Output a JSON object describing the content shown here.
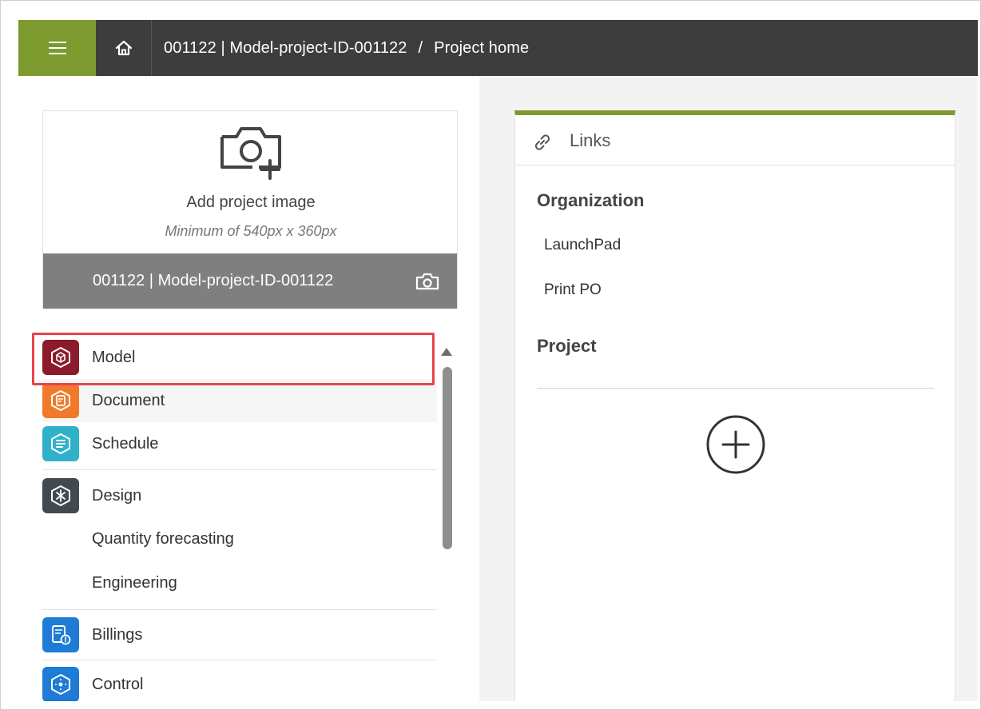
{
  "header": {
    "project": "001122 | Model-project-ID-001122",
    "separator": "/",
    "page": "Project home"
  },
  "project_image": {
    "add_label": "Add project image",
    "min_size": "Minimum of 540px x 360px",
    "project_name": "001122 | Model-project-ID-001122"
  },
  "nav": {
    "items": [
      {
        "label": "Model",
        "icon": "model-cube-icon",
        "color": "#8b1a2a"
      },
      {
        "label": "Document",
        "icon": "document-icon",
        "color": "#f07a2a"
      },
      {
        "label": "Schedule",
        "icon": "schedule-icon",
        "color": "#2fb2c9"
      },
      {
        "label": "Design",
        "icon": "design-icon",
        "color": "#424a4f"
      },
      {
        "label": "Quantity forecasting"
      },
      {
        "label": "Engineering"
      },
      {
        "label": "Billings",
        "icon": "billings-icon",
        "color": "#1e7bd6"
      },
      {
        "label": "Control",
        "icon": "control-icon",
        "color": "#1e7bd6"
      }
    ]
  },
  "links": {
    "title": "Links",
    "organization_title": "Organization",
    "organization_items": [
      "LaunchPad",
      "Print PO"
    ],
    "project_title": "Project"
  },
  "colors": {
    "brand_green": "#7c9a2e",
    "topbar": "#3d3d3d",
    "highlight": "#e8434b"
  }
}
